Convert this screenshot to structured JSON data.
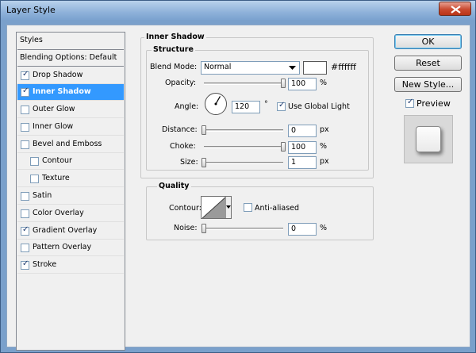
{
  "window": {
    "title": "Layer Style"
  },
  "styles_list": {
    "items": [
      {
        "label": "Styles",
        "checkbox": false,
        "checked": false,
        "selected": false,
        "indent": false
      },
      {
        "label": "Blending Options: Default",
        "checkbox": false,
        "checked": false,
        "selected": false,
        "indent": false
      },
      {
        "label": "Drop Shadow",
        "checkbox": true,
        "checked": true,
        "selected": false,
        "indent": false
      },
      {
        "label": "Inner Shadow",
        "checkbox": true,
        "checked": true,
        "selected": true,
        "indent": false
      },
      {
        "label": "Outer Glow",
        "checkbox": true,
        "checked": false,
        "selected": false,
        "indent": false
      },
      {
        "label": "Inner Glow",
        "checkbox": true,
        "checked": false,
        "selected": false,
        "indent": false
      },
      {
        "label": "Bevel and Emboss",
        "checkbox": true,
        "checked": false,
        "selected": false,
        "indent": false
      },
      {
        "label": "Contour",
        "checkbox": true,
        "checked": false,
        "selected": false,
        "indent": true
      },
      {
        "label": "Texture",
        "checkbox": true,
        "checked": false,
        "selected": false,
        "indent": true
      },
      {
        "label": "Satin",
        "checkbox": true,
        "checked": false,
        "selected": false,
        "indent": false
      },
      {
        "label": "Color Overlay",
        "checkbox": true,
        "checked": false,
        "selected": false,
        "indent": false
      },
      {
        "label": "Gradient Overlay",
        "checkbox": true,
        "checked": true,
        "selected": false,
        "indent": false
      },
      {
        "label": "Pattern Overlay",
        "checkbox": true,
        "checked": false,
        "selected": false,
        "indent": false
      },
      {
        "label": "Stroke",
        "checkbox": true,
        "checked": true,
        "selected": false,
        "indent": false
      }
    ]
  },
  "inner_shadow": {
    "title": "Inner Shadow",
    "structure_title": "Structure",
    "blend_mode_label": "Blend Mode:",
    "blend_mode_value": "Normal",
    "color_hex": "#ffffff",
    "color_label": "#ffffff",
    "opacity_label": "Opacity:",
    "opacity_value": "100",
    "opacity_fraction": 1.0,
    "angle_label": "Angle:",
    "angle_value": "120",
    "degree_symbol": "°",
    "use_global_light_label": "Use Global Light",
    "use_global_light_checked": true,
    "distance_label": "Distance:",
    "distance_value": "0",
    "distance_fraction": 0.0,
    "choke_label": "Choke:",
    "choke_value": "100",
    "choke_fraction": 1.0,
    "size_label": "Size:",
    "size_value": "1",
    "size_fraction": 0.004,
    "unit_percent": "%",
    "unit_px": "px"
  },
  "quality": {
    "title": "Quality",
    "contour_label": "Contour:",
    "anti_aliased_label": "Anti-aliased",
    "anti_aliased_checked": false,
    "noise_label": "Noise:",
    "noise_value": "0",
    "noise_fraction": 0.0,
    "unit_percent": "%"
  },
  "buttons": {
    "ok": "OK",
    "reset": "Reset",
    "new_style": "New Style...",
    "preview_label": "Preview",
    "preview_checked": true
  },
  "icons": {
    "close": "close-icon",
    "dropdown": "chevron-down-icon",
    "check": "checkmark-icon"
  }
}
